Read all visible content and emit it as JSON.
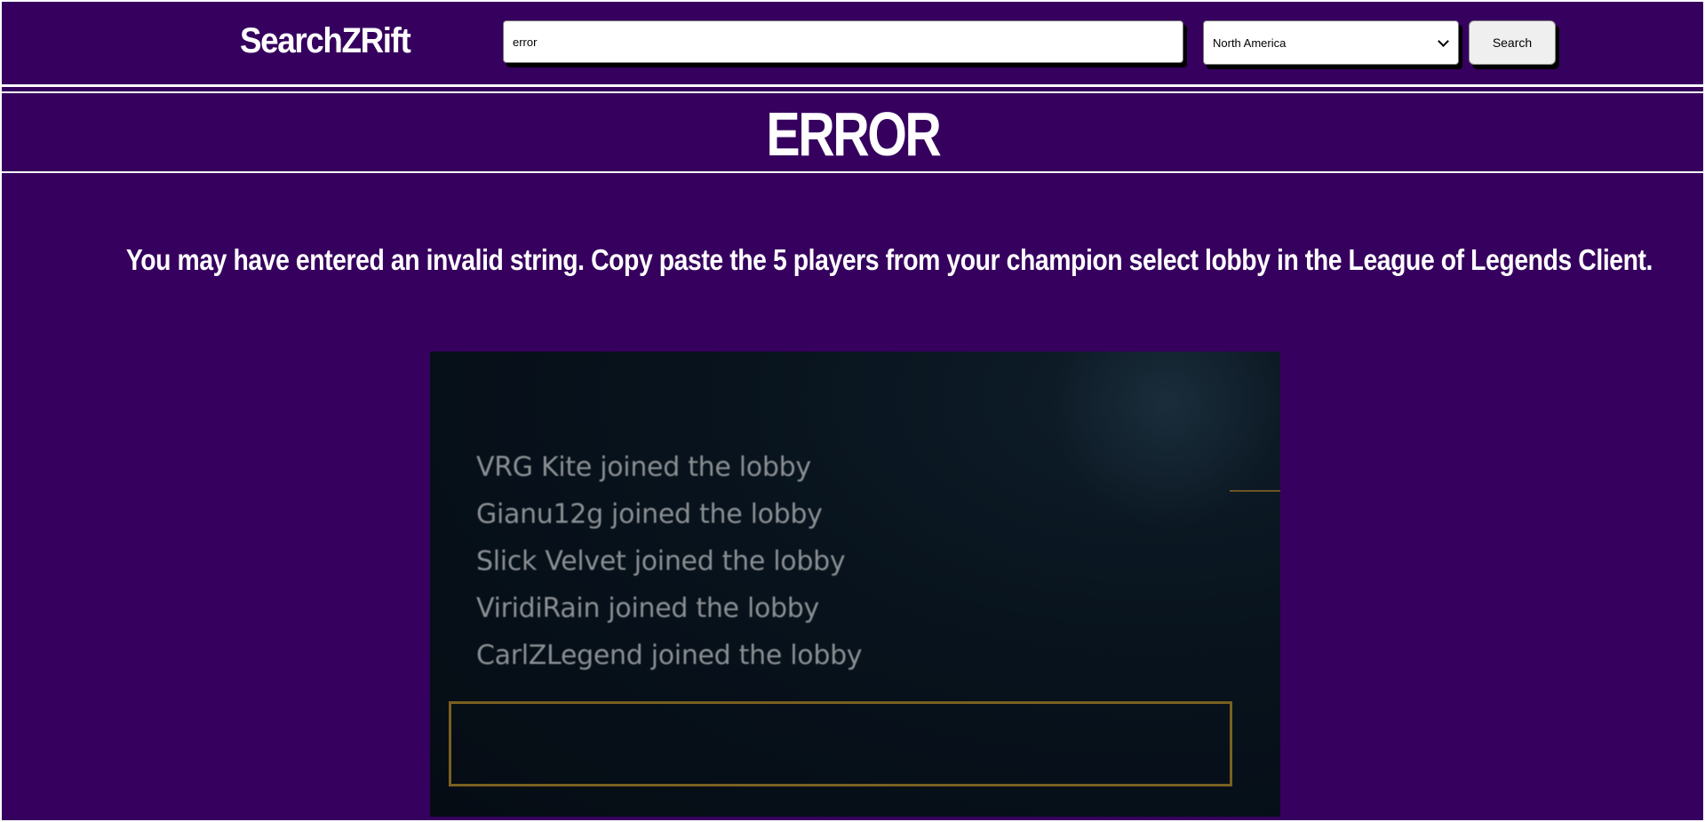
{
  "header": {
    "logo_text": "SearchZRift",
    "search_value": "error",
    "region_selected": "North America",
    "search_button_label": "Search"
  },
  "title": "ERROR",
  "message": "You may have entered an invalid string. Copy paste the 5 players from your champion select lobby in the League of Legends Client.",
  "example_image": {
    "lobby_lines": [
      "VRG Kite joined the lobby",
      "Gianu12g joined the lobby",
      "Slick Velvet joined the lobby",
      "ViridiRain joined the lobby",
      "CarlZLegend joined the lobby"
    ]
  },
  "colors": {
    "background": "#36005e",
    "text": "#ffffff",
    "gold_border": "#7a6020"
  }
}
